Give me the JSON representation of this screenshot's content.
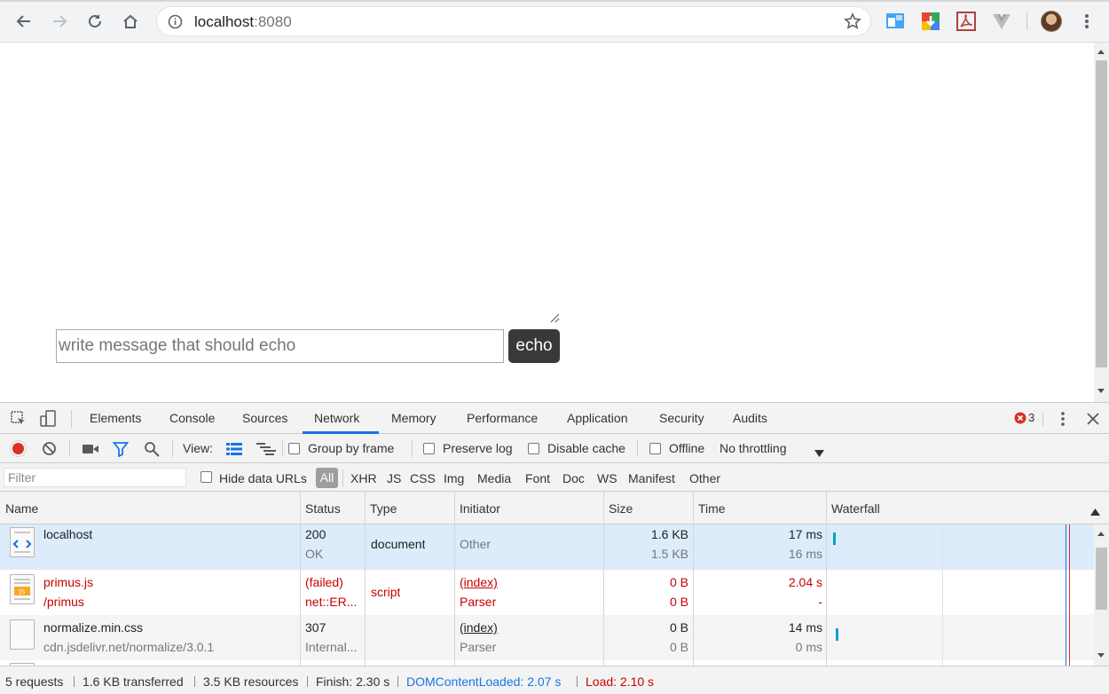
{
  "browser": {
    "url_host": "localhost",
    "url_port": ":8080"
  },
  "page": {
    "input_placeholder": "write message that should echo",
    "echo_label": "echo"
  },
  "devtools": {
    "tabs": [
      "Elements",
      "Console",
      "Sources",
      "Network",
      "Memory",
      "Performance",
      "Application",
      "Security",
      "Audits"
    ],
    "active_tab": "Network",
    "error_count": "3",
    "toolbar": {
      "view_label": "View:",
      "group_by_frame": "Group by frame",
      "preserve_log": "Preserve log",
      "disable_cache": "Disable cache",
      "offline": "Offline",
      "throttling": "No throttling"
    },
    "filter_bar": {
      "filter_placeholder": "Filter",
      "hide_data_urls": "Hide data URLs",
      "types": [
        "All",
        "XHR",
        "JS",
        "CSS",
        "Img",
        "Media",
        "Font",
        "Doc",
        "WS",
        "Manifest",
        "Other"
      ]
    },
    "columns": [
      "Name",
      "Status",
      "Type",
      "Initiator",
      "Size",
      "Time",
      "Waterfall"
    ],
    "rows": [
      {
        "name": "localhost",
        "path": "",
        "status": "200",
        "status_text": "OK",
        "type": "document",
        "initiator": "Other",
        "initiator_sub": "",
        "size": "1.6 KB",
        "size_sub": "1.5 KB",
        "time": "17 ms",
        "time_sub": "16 ms"
      },
      {
        "name": "primus.js",
        "path": "/primus",
        "status": "(failed)",
        "status_text": "net::ER...",
        "type": "script",
        "initiator": "(index)",
        "initiator_sub": "Parser",
        "size": "0 B",
        "size_sub": "0 B",
        "time": "2.04 s",
        "time_sub": "-"
      },
      {
        "name": "normalize.min.css",
        "path": "cdn.jsdelivr.net/normalize/3.0.1",
        "status": "307",
        "status_text": "Internal...",
        "type": "",
        "initiator": "(index)",
        "initiator_sub": "Parser",
        "size": "0 B",
        "size_sub": "0 B",
        "time": "14 ms",
        "time_sub": "0 ms"
      }
    ],
    "status_bar": {
      "requests": "5 requests",
      "transferred": "1.6 KB transferred",
      "resources": "3.5 KB resources",
      "finish": "Finish: 2.30 s",
      "dom_content_loaded": "DOMContentLoaded: 2.07 s",
      "load": "Load: 2.10 s"
    }
  },
  "colors": {
    "accent_blue": "#1a73e8",
    "error_red": "#c80000",
    "selected_row": "#dcecfb",
    "dcl_blue": "#1a73e8",
    "load_red": "#d93025"
  }
}
